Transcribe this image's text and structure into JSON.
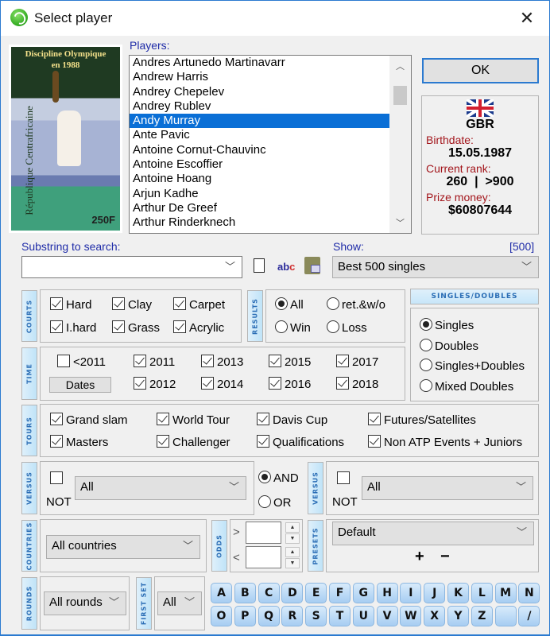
{
  "window": {
    "title": "Select player"
  },
  "stamp": {
    "banner_line1": "Discipline Olympique",
    "banner_line2": "en 1988",
    "side_text": "République Centrafricaine",
    "value": "250F"
  },
  "players": {
    "label": "Players:",
    "items": [
      "Andres Artunedo Martinavarr",
      "Andrew Harris",
      "Andrey Chepelev",
      "Andrey Rublev",
      "Andy Murray",
      "Ante Pavic",
      "Antoine Cornut-Chauvinc",
      "Antoine Escoffier",
      "Antoine Hoang",
      "Arjun Kadhe",
      "Arthur De Greef",
      "Arthur Rinderknech"
    ],
    "selected": "Andy Murray"
  },
  "ok_label": "OK",
  "info": {
    "country": "GBR",
    "birthdate_label": "Birthdate:",
    "birthdate": "15.05.1987",
    "rank_label": "Current rank:",
    "rank": "260  |  >900",
    "prize_label": "Prize money:",
    "prize": "$60807644"
  },
  "search": {
    "label": "Substring to search:",
    "value": ""
  },
  "show": {
    "label": "Show:",
    "count": "[500]",
    "value": "Best 500 singles"
  },
  "courts": {
    "tab": "COURTS",
    "items": [
      {
        "label": "Hard",
        "checked": true
      },
      {
        "label": "Clay",
        "checked": true
      },
      {
        "label": "Carpet",
        "checked": true
      },
      {
        "label": "I.hard",
        "checked": true
      },
      {
        "label": "Grass",
        "checked": true
      },
      {
        "label": "Acrylic",
        "checked": true
      }
    ]
  },
  "results": {
    "tab": "RESULTS",
    "items": [
      {
        "label": "All",
        "selected": true
      },
      {
        "label": "ret.&w/o",
        "selected": false
      },
      {
        "label": "Win",
        "selected": false
      },
      {
        "label": "Loss",
        "selected": false
      }
    ]
  },
  "singles_doubles": {
    "header": "SINGLES/DOUBLES",
    "items": [
      {
        "label": "Singles",
        "selected": true
      },
      {
        "label": "Doubles",
        "selected": false
      },
      {
        "label": "Singles+Doubles",
        "selected": false
      },
      {
        "label": "Mixed Doubles",
        "selected": false
      }
    ]
  },
  "time": {
    "tab": "TIME",
    "before": {
      "label": "<2011",
      "checked": false
    },
    "dates_label": "Dates",
    "years": [
      {
        "label": "2011",
        "checked": true
      },
      {
        "label": "2012",
        "checked": true
      },
      {
        "label": "2013",
        "checked": true
      },
      {
        "label": "2014",
        "checked": true
      },
      {
        "label": "2015",
        "checked": true
      },
      {
        "label": "2016",
        "checked": true
      },
      {
        "label": "2017",
        "checked": true
      },
      {
        "label": "2018",
        "checked": true
      }
    ]
  },
  "tours": {
    "tab": "TOURS",
    "items": [
      {
        "label": "Grand slam",
        "checked": true
      },
      {
        "label": "World Tour",
        "checked": true
      },
      {
        "label": "Davis Cup",
        "checked": true
      },
      {
        "label": "Futures/Satellites",
        "checked": true
      },
      {
        "label": "Masters",
        "checked": true
      },
      {
        "label": "Challenger",
        "checked": true
      },
      {
        "label": "Qualifications",
        "checked": true
      },
      {
        "label": "Non ATP Events + Juniors",
        "checked": true
      }
    ]
  },
  "versus": {
    "tab": "VERSUS",
    "left": {
      "not_label": "NOT",
      "value": "All"
    },
    "right": {
      "not_label": "NOT",
      "value": "All"
    },
    "and_label": "AND",
    "or_label": "OR"
  },
  "countries": {
    "tab": "COUNTRIES",
    "value": "All countries"
  },
  "odds": {
    "tab": "ODDS",
    "gt": ">",
    "lt": "<",
    "gt_value": "",
    "lt_value": ""
  },
  "presets": {
    "tab": "PRESETS",
    "value": "Default",
    "add": "+",
    "remove": "−"
  },
  "rounds": {
    "tab": "ROUNDS",
    "value": "All rounds"
  },
  "first_set": {
    "tab": "FIRST SET",
    "value": "All"
  },
  "letters": [
    "A",
    "B",
    "C",
    "D",
    "E",
    "F",
    "G",
    "H",
    "I",
    "J",
    "K",
    "L",
    "M",
    "N",
    "O",
    "P",
    "Q",
    "R",
    "S",
    "T",
    "U",
    "V",
    "W",
    "X",
    "Y",
    "Z",
    " ",
    "/"
  ]
}
